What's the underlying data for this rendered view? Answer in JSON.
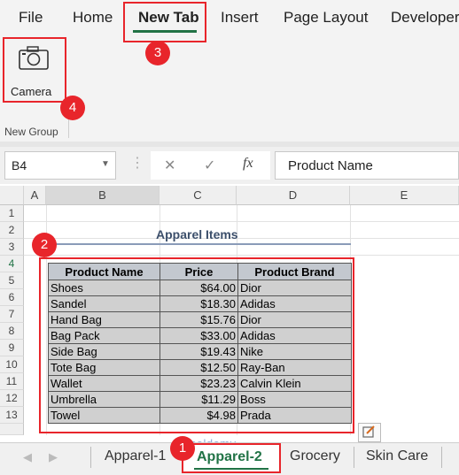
{
  "ribbon": {
    "tabs": [
      "File",
      "Home",
      "New Tab",
      "Insert",
      "Page Layout",
      "Developer"
    ],
    "camera_label": "Camera",
    "group_label": "New Group"
  },
  "formula_bar": {
    "name_box": "B4",
    "cancel_symbol": "✕",
    "enter_symbol": "✓",
    "fx_symbol": "fx",
    "content": "Product Name"
  },
  "grid": {
    "columns": [
      "A",
      "B",
      "C",
      "D",
      "E"
    ],
    "rows": [
      "1",
      "2",
      "3",
      "4",
      "5",
      "6",
      "7",
      "8",
      "9",
      "10",
      "11",
      "12",
      "13"
    ]
  },
  "table": {
    "title": "Apparel Items",
    "headers": [
      "Product Name",
      "Price",
      "Product Brand"
    ],
    "rows": [
      [
        "Shoes",
        "$64.00",
        "Dior"
      ],
      [
        "Sandel",
        "$18.30",
        "Adidas"
      ],
      [
        "Hand Bag",
        "$15.76",
        "Dior"
      ],
      [
        "Bag Pack",
        "$33.00",
        "Adidas"
      ],
      [
        "Side Bag",
        "$19.43",
        "Nike"
      ],
      [
        "Tote Bag",
        "$12.50",
        "Ray-Ban"
      ],
      [
        "Wallet",
        "$23.23",
        "Calvin Klein"
      ],
      [
        "Umbrella",
        "$11.29",
        "Boss"
      ],
      [
        "Towel",
        "$4.98",
        "Prada"
      ]
    ]
  },
  "sheet_tabs": [
    "Apparel-1",
    "Apparel-2",
    "Grocery",
    "Skin Care"
  ],
  "active_sheet": "Apparel-2",
  "watermark": "exceldemy",
  "annotations": [
    "1",
    "2",
    "3",
    "4"
  ],
  "colors": {
    "accent_red": "#e8252b",
    "active_tab_green": "#217346",
    "header_fill": "#c3c8cf"
  }
}
